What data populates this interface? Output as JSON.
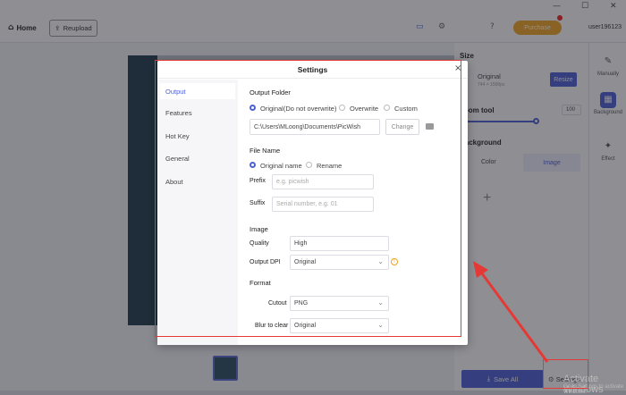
{
  "window": {
    "minimize": "—",
    "maximize": "☐",
    "close": "✕"
  },
  "topbar": {
    "home_label": "Home",
    "reupload_label": "Reupload",
    "purchase_label": "Purchase",
    "username": "user196123"
  },
  "right_panel": {
    "size_title": "Size",
    "original_label": "Original",
    "original_dims": "744 × 1500px",
    "resize_label": "Resize",
    "zoom_tool_label": "Zoom tool",
    "zoom_value": "100",
    "background_title": "Background",
    "tab_color": "Color",
    "tab_image": "Image",
    "add_symbol": "+",
    "save_all_label": "Save All",
    "settings_label": "Settings"
  },
  "sidebar": {
    "manually_label": "Manually",
    "background_label": "Background",
    "effect_label": "Effect"
  },
  "watermark": {
    "line1": "Activate Windows",
    "line2": "Go to Settings to activate Windows."
  },
  "dialog": {
    "title": "Settings",
    "close_symbol": "×",
    "nav": [
      "Output",
      "Features",
      "Hot Key",
      "General",
      "About"
    ],
    "output_folder_title": "Output Folder",
    "folder_options": [
      "Original(Do not overwrite)",
      "Overwrite",
      "Custom"
    ],
    "folder_path": "C:\\Users\\MLoong\\Documents\\PicWish",
    "change_label": "Change",
    "file_name_title": "File Name",
    "file_name_options": [
      "Original name",
      "Rename"
    ],
    "prefix_label": "Prefix",
    "prefix_placeholder": "e.g. picwish",
    "suffix_label": "Suffix",
    "suffix_placeholder": "Serial number, e.g. 01",
    "image_title": "Image",
    "quality_label": "Quality",
    "quality_value": "High",
    "dpi_label": "Output DPI",
    "dpi_value": "Original",
    "format_title": "Format",
    "cutout_label": "Cutout",
    "cutout_value": "PNG",
    "blur_label": "Blur to clear",
    "blur_value": "Original"
  },
  "colors": {
    "accent": "#4d5fd6",
    "highlight": "#e53935",
    "purchase": "#f5a623"
  }
}
